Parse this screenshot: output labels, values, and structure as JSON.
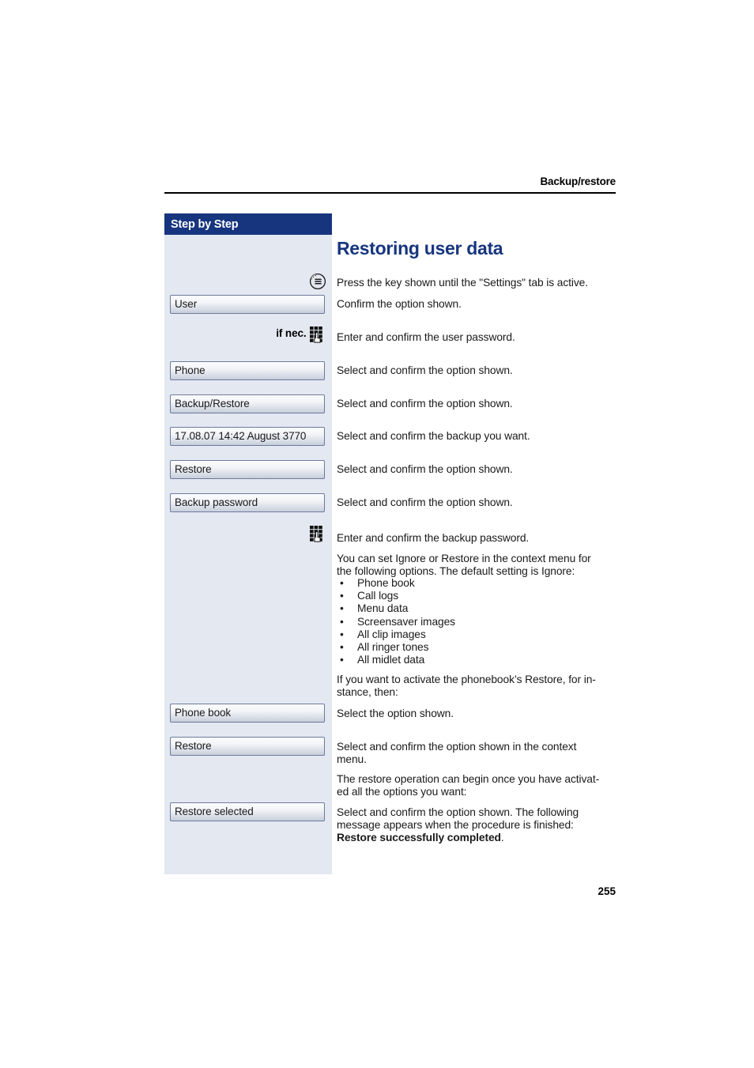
{
  "header": {
    "running_title": "Backup/restore"
  },
  "sidebar": {
    "title": "Step by Step",
    "if_nec_label": "if nec.",
    "steps": [
      {
        "label": "User",
        "icon": null
      },
      {
        "label": "Phone",
        "icon": null
      },
      {
        "label": "Backup/Restore",
        "icon": null
      },
      {
        "label": "17.08.07 14:42 August 3770",
        "icon": null
      },
      {
        "label": "Restore",
        "icon": null
      },
      {
        "label": "Backup password",
        "icon": null
      },
      {
        "label": "Phone book",
        "icon": null
      },
      {
        "label": "Restore",
        "icon": null
      },
      {
        "label": "Restore selected",
        "icon": null
      }
    ],
    "icons": {
      "menu_key": "menu-key-icon",
      "keypad": "keypad-icon"
    }
  },
  "main": {
    "title": "Restoring user data",
    "steps": [
      "Press the key shown until the \"Settings\" tab is active.",
      "Confirm the option shown.",
      "Enter and confirm the user password.",
      "Select and confirm the option shown.",
      "Select and confirm the option shown.",
      "Select and confirm the backup you want.",
      "Select and confirm the option shown.",
      "Select and confirm the option shown.",
      "Enter and confirm the backup password."
    ],
    "note_intro_line1": "You can set Ignore or Restore in the context menu for",
    "note_intro_line2": "the following options. The default setting is Ignore:",
    "options": [
      "Phone book",
      "Call logs",
      "Menu data",
      "Screensaver images",
      "All clip images",
      "All ringer tones",
      "All midlet data"
    ],
    "bullet_char": "•",
    "activate_note_line1": "If you want to activate the phonebook’s Restore, for in-",
    "activate_note_line2": "stance, then:",
    "select_option_text": "Select the option shown.",
    "context_menu_line1": "Select and confirm the option shown in the context",
    "context_menu_line2": "menu.",
    "begin_note_line1": "The restore operation can begin once you have activat-",
    "begin_note_line2": "ed all the options you want:",
    "final_line1": "Select and confirm the option shown. The following",
    "final_line2": "message appears when the procedure is finished:",
    "final_bold": "Restore successfully completed",
    "final_period": "."
  },
  "footer": {
    "page_number": "255"
  },
  "colors": {
    "brand_navy": "#17357f",
    "sidebar_bg": "#e4e8f1",
    "button_border": "#6b7a9c"
  }
}
